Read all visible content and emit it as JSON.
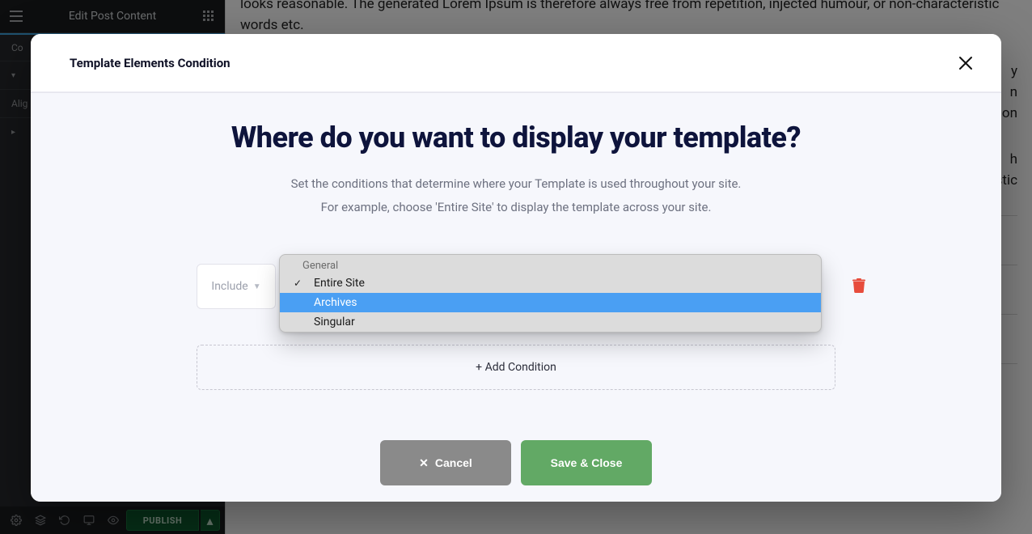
{
  "editor": {
    "headerTitle": "Edit Post Content",
    "publishLabel": "PUBLISH",
    "sidebarTabs": {
      "content": "Co",
      "align": "Alig"
    },
    "bodyPara1": "looks reasonable. The generated Lorem Ipsum is therefore always free from repetition, injected humour, or non-characteristic words etc.",
    "bodyPara2Tail": "y\nn\ns on",
    "bodyPara3Tail": "h\nstic"
  },
  "modal": {
    "title": "Template Elements Condition",
    "heading": "Where do you want to display your template?",
    "subline1": "Set the conditions that determine where your Template is used throughout your site.",
    "subline2": "For example, choose 'Entire Site' to display the template across your site.",
    "condition": {
      "mode": "Include",
      "dropdown": {
        "groupLabel": "General",
        "options": [
          {
            "label": "Entire Site",
            "selected": true,
            "highlighted": false
          },
          {
            "label": "Archives",
            "selected": false,
            "highlighted": true
          },
          {
            "label": "Singular",
            "selected": false,
            "highlighted": false
          }
        ]
      }
    },
    "addCondition": "+ Add Condition",
    "cancel": "Cancel",
    "save": "Save & Close"
  }
}
